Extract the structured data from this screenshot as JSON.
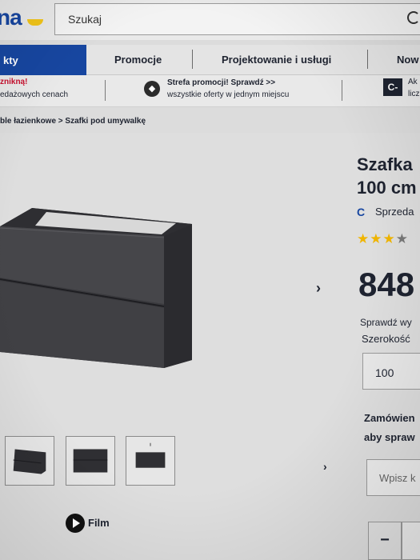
{
  "header": {
    "logo_text": "na",
    "search_placeholder": "Szukaj"
  },
  "nav": {
    "items": [
      {
        "label": "kty"
      },
      {
        "label": "Promocje"
      },
      {
        "label": "Projektowanie i usługi"
      },
      {
        "label": "Now"
      }
    ]
  },
  "promo": {
    "left_title": "znikną!",
    "left_sub": "edażowych cenach",
    "center_line1": "Strefa promocji! Sprawdź >>",
    "center_line2": "wszystkie oferty w jednym miejscu",
    "right_icon": "C-",
    "right_line1": "Ak",
    "right_line2": "licz"
  },
  "breadcrumb": {
    "text": "ble łazienkowe  >  Szafki pod umywalkę"
  },
  "product": {
    "title_line1": "Szafka",
    "title_line2": "100 cm",
    "seller_icon": "C",
    "seller_text": "Sprzeda",
    "rating": 3.5,
    "stars_full": "★★★",
    "stars_half": "★",
    "price": "848",
    "check_text": "Sprawdź wy",
    "width_label": "Szerokość",
    "width_value": "100",
    "order_line1": "Zamówien",
    "order_line2": "aby spraw",
    "postcode_placeholder": "Wpisz k",
    "qty_minus": "−",
    "film_label": "Film",
    "next_arrow": "›",
    "thumb_next": "›"
  },
  "colors": {
    "brand_blue": "#1746a0",
    "promo_red": "#c8102e",
    "star_yellow": "#f0b500"
  }
}
